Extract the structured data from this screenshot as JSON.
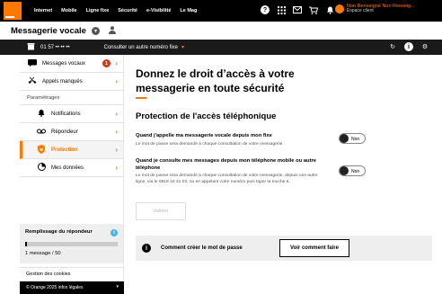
{
  "topbar": {
    "nav": [
      "Internet",
      "Mobile",
      "Ligne fixe",
      "Sécurité",
      "e-Visibilité",
      "Le Mag"
    ],
    "user_name": "Non Renseigné Non Renseig...",
    "user_sub": "Espace client"
  },
  "title": {
    "page_title": "Messagerie vocale"
  },
  "subbar": {
    "phone_number": "01 57 •• •• ••",
    "consult_label": "Consulter un autre numéro fixe"
  },
  "sidebar": {
    "items": [
      {
        "label": "Messages vocaux",
        "badge": "1"
      },
      {
        "label": "Appels manqués"
      }
    ],
    "section_label": "Paramètrages",
    "sub_items": [
      {
        "label": "Notifications"
      },
      {
        "label": "Répondeur"
      },
      {
        "label": "Protection"
      },
      {
        "label": "Mes données"
      }
    ],
    "storage": {
      "title": "Remplissage du répondeur",
      "info": "i",
      "used": 1,
      "total": 50,
      "text": "1 message / 50"
    },
    "cookies": "Gestion des cookies",
    "footer": "© Orange 2025 infos légales"
  },
  "main": {
    "heading": "Donnez le droit d’accès à votre messagerie en toute sécurité",
    "section_title": "Protection de l'accès téléphonique",
    "options": [
      {
        "title": "Quand j'appelle ma messagerie vocale depuis mon fixe",
        "desc": "Le mot de passe sera demandé à chaque consultation de votre messagerie.",
        "toggle": "Non"
      },
      {
        "title": "Quand je consulte mes messages depuis mon téléphone mobile ou autre téléphone",
        "desc": "Le mot de passe sera demandé à chaque consultation de votre messagerie, depuis une autre ligne, via le 0819 10 31 03, ou en appelant votre numéro puis taper la touche 6.",
        "toggle": "Non"
      }
    ],
    "validate_label": "Valider",
    "info": {
      "text": "Comment créer le mot de passe",
      "button": "Voir comment faire"
    }
  },
  "colors": {
    "accent": "#ff7900",
    "badge": "#cd3c14",
    "info": "#4bb4e6"
  }
}
